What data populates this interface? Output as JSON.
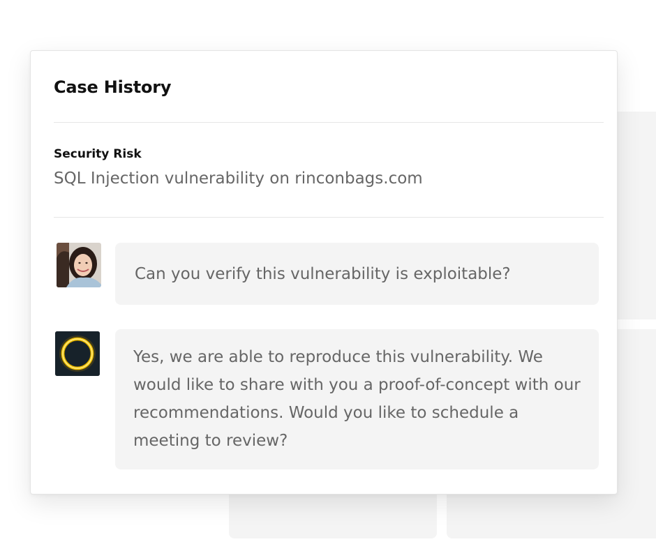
{
  "card": {
    "title": "Case History"
  },
  "risk": {
    "label": "Security Risk",
    "value": "SQL Injection vulnerability on rinconbags.com"
  },
  "messages": [
    {
      "author_avatar": "user-avatar",
      "text": "Can you verify this vulnerability is exploitable?"
    },
    {
      "author_avatar": "agent-avatar",
      "text": "Yes, we are able to reproduce this vulnerability. We would like to share with you a proof-of-concept with our recommendations. Would you like to schedule a meeting to review?"
    }
  ],
  "colors": {
    "bubble_background": "#f4f4f4",
    "muted_text": "#666666",
    "title_text": "#111111",
    "agent_avatar_background": "#17222a",
    "agent_ring": "#f2c200"
  }
}
